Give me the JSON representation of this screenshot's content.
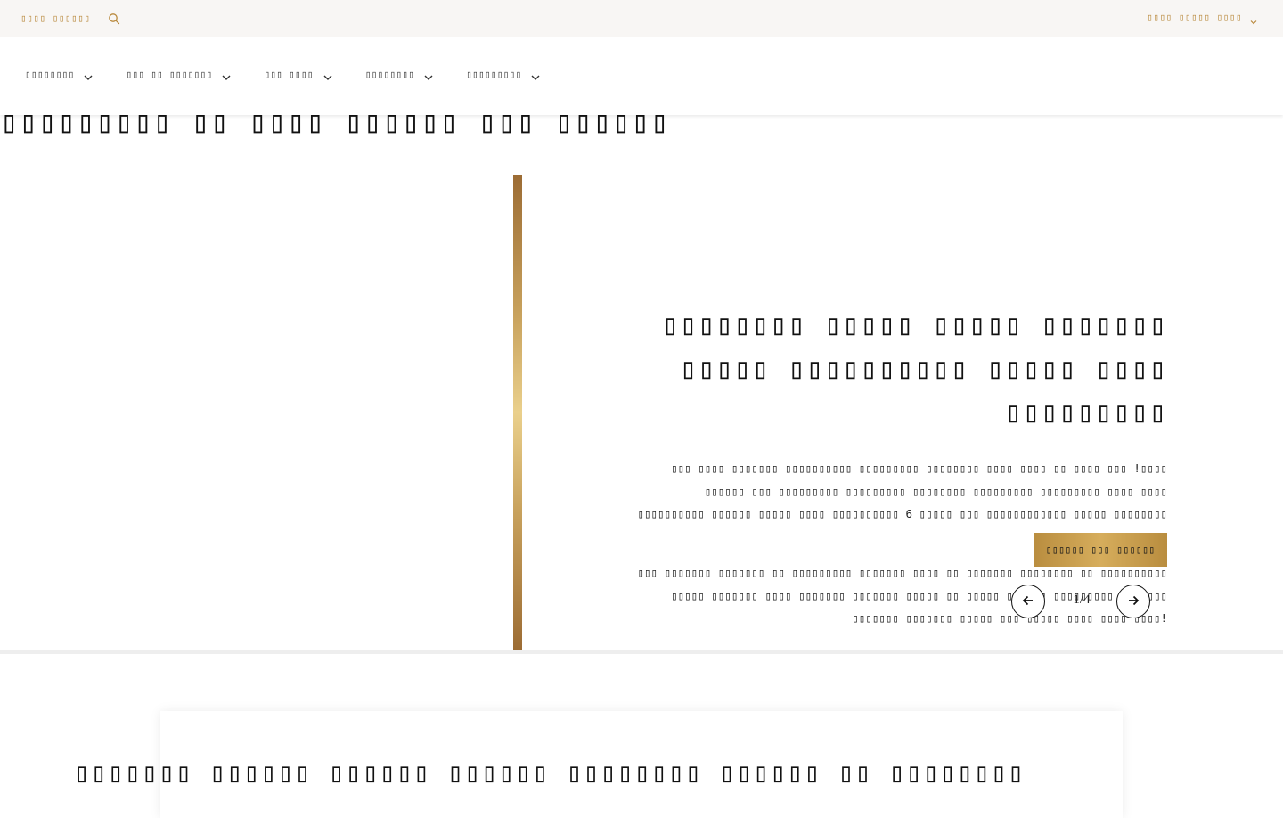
{
  "topbar": {
    "search_label": "▯▯▯▯ ▯▯▯▯▯▯",
    "search_icon": "search-icon",
    "language_label": "▯▯▯▯ ▯▯▯▯▯ ▯▯▯▯",
    "accent_color": "#b9893c"
  },
  "nav": {
    "items": [
      {
        "label": "▯▯▯▯▯▯▯▯",
        "icon": "chevron-down-icon"
      },
      {
        "label": "▯▯▯ ▯▯ ▯▯▯▯▯▯▯",
        "icon": "chevron-down-icon"
      },
      {
        "label": "▯▯▯ ▯▯▯▯",
        "icon": "chevron-down-icon"
      },
      {
        "label": "▯▯▯▯▯▯▯▯",
        "icon": "chevron-down-icon"
      },
      {
        "label": "▯▯▯▯▯▯▯▯▯",
        "icon": "chevron-down-icon"
      }
    ]
  },
  "page_heading": "▯▯▯▯▯▯▯▯▯ ▯▯ ▯▯▯▯ ▯▯▯▯▯▯ ▯▯▯ ▯▯▯▯▯▯",
  "hero": {
    "title_line1": "▯▯▯▯▯▯▯▯ ▯▯▯▯▯ ▯▯▯▯▯ ▯▯▯▯▯▯▯",
    "title_line2": "▯▯▯▯▯ ▯▯▯▯▯▯▯▯▯▯ ▯▯▯▯▯ ▯▯▯▯ ▯▯▯▯▯▯▯▯▯",
    "paragraph1": "▯▯▯ ▯▯▯▯ ▯▯▯▯▯▯▯ ▯▯▯▯▯▯▯▯▯▯ ▯▯▯▯▯▯▯▯▯ ▯▯▯▯▯▯▯▯ ▯▯▯▯ ▯▯▯▯ ▯▯ ▯▯▯▯ ▯▯▯ !▯▯▯▯ ▯▯▯▯▯▯ ▯▯▯ ▯▯▯▯▯▯▯▯▯ ▯▯▯▯▯▯▯▯▯ ▯▯▯▯▯▯▯▯ ▯▯▯▯▯▯▯▯▯ ▯▯▯▯▯▯▯▯▯ ▯▯▯▯ ▯▯▯▯ ▯▯▯▯▯▯▯▯▯▯ ▯▯▯▯▯▯ ▯▯▯▯▯ ▯▯▯▯ ▯▯▯▯▯▯▯▯▯▯ 6 ▯▯▯▯▯ ▯▯▯ ▯▯▯▯▯▯▯▯▯▯▯▯ ▯▯▯▯▯ ▯▯▯▯▯▯▯▯ ▯▯▯▯▯ ▯▯▯▯ ▯▯▯▯▯▯▯.",
    "paragraph2": "▯▯▯ ▯▯▯▯▯▯▯ ▯▯▯▯▯▯▯ ▯▯ ▯▯▯▯▯▯▯▯▯ ▯▯▯▯▯▯▯ ▯▯▯▯ ▯▯ ▯▯▯▯▯▯▯ ▯▯▯▯▯▯▯▯ ▯▯ ▯▯▯▯▯▯▯▯▯▯ ▯▯▯▯▯ ▯▯▯▯▯▯▯ ▯▯▯▯ ▯▯▯▯▯▯▯ ▯▯▯▯▯▯▯ ▯▯▯▯▯ ▯▯ ▯▯▯▯▯ ▯▯▯▯▯▯ ▯▯▯▯▯▯▯▯▯ ▯▯ ▯▯▯▯ ▯▯▯▯▯▯▯ ▯▯▯▯▯▯▯ ▯▯▯▯▯ ▯▯▯ ▯▯▯▯▯ ▯▯▯▯ ▯▯▯▯ ▯▯▯▯!",
    "cta_label": "▯▯▯▯▯▯ ▯▯▯ ▯▯▯▯▯▯",
    "cta_color": "#c9a04f",
    "prev_icon": "arrow-left-icon",
    "next_icon": "arrow-right-icon",
    "pager_text": "1/4"
  },
  "card": {
    "title": "▯▯▯▯▯▯▯ ▯▯▯▯▯▯ ▯▯▯▯▯▯ ▯▯▯▯▯▯ ▯▯▯▯▯▯▯▯ ▯▯▯▯▯▯ ▯▯ ▯▯▯▯▯▯▯▯"
  }
}
